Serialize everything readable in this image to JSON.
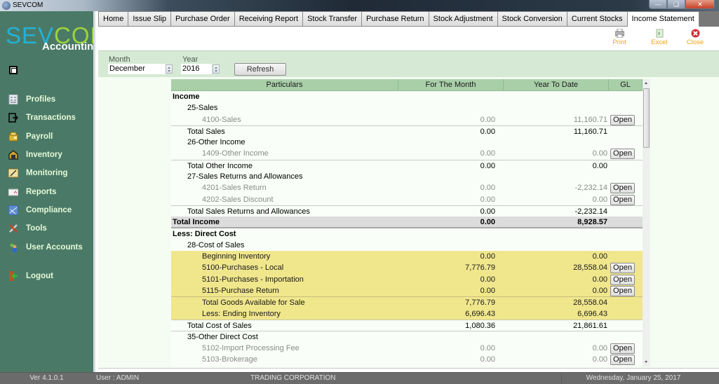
{
  "window": {
    "title": "SEVCOM",
    "controls": [
      "minimize",
      "maximize",
      "close"
    ]
  },
  "brand": {
    "logo_part1": "SEV",
    "logo_part2": "COM",
    "subtitle": "Accounting"
  },
  "sidebar": {
    "items": [
      {
        "label": "Profiles",
        "icon": "profiles-icon"
      },
      {
        "label": "Transactions",
        "icon": "transactions-icon"
      },
      {
        "label": "Payroll",
        "icon": "payroll-icon"
      },
      {
        "label": "Inventory",
        "icon": "inventory-icon"
      },
      {
        "label": "Monitoring",
        "icon": "monitoring-icon"
      },
      {
        "label": "Reports",
        "icon": "reports-icon"
      },
      {
        "label": "Compliance",
        "icon": "compliance-icon"
      },
      {
        "label": "Tools",
        "icon": "tools-icon"
      },
      {
        "label": "User Accounts",
        "icon": "user-accounts-icon"
      },
      {
        "label": "Logout",
        "icon": "logout-icon"
      }
    ]
  },
  "tabs": [
    {
      "label": "Home",
      "active": false
    },
    {
      "label": "Issue Slip",
      "active": false
    },
    {
      "label": "Purchase Order",
      "active": false
    },
    {
      "label": "Receiving Report",
      "active": false
    },
    {
      "label": "Stock Transfer",
      "active": false
    },
    {
      "label": "Purchase Return",
      "active": false
    },
    {
      "label": "Stock Adjustment",
      "active": false
    },
    {
      "label": "Stock Conversion",
      "active": false
    },
    {
      "label": "Current Stocks",
      "active": false
    },
    {
      "label": "Income Statement",
      "active": true
    }
  ],
  "toolbar": {
    "print_label": "Print",
    "excel_label": "Excel",
    "close_label": "Close"
  },
  "filter": {
    "month_label": "Month",
    "month_value": "December",
    "year_label": "Year",
    "year_value": "2016",
    "refresh_label": "Refresh"
  },
  "grid": {
    "columns": [
      "Particulars",
      "For The Month",
      "Year To Date",
      "GL"
    ],
    "open_label": "Open",
    "rows": [
      {
        "type": "header",
        "level": 0,
        "particulars": "Income",
        "month": "",
        "ytd": "",
        "gl": false
      },
      {
        "type": "group",
        "level": 1,
        "particulars": "25-Sales",
        "month": "",
        "ytd": "",
        "gl": false
      },
      {
        "type": "account",
        "level": 2,
        "particulars": "4100-Sales",
        "month": "0.00",
        "ytd": "11,160.71",
        "gl": true
      },
      {
        "type": "total",
        "level": 1,
        "particulars": "Total Sales",
        "month": "0.00",
        "ytd": "11,160.71",
        "gl": false
      },
      {
        "type": "group",
        "level": 1,
        "particulars": "26-Other Income",
        "month": "",
        "ytd": "",
        "gl": false
      },
      {
        "type": "account",
        "level": 2,
        "particulars": "1409-Other Income",
        "month": "0.00",
        "ytd": "0.00",
        "gl": true
      },
      {
        "type": "total",
        "level": 1,
        "particulars": "Total Other Income",
        "month": "0.00",
        "ytd": "0.00",
        "gl": false
      },
      {
        "type": "group",
        "level": 1,
        "particulars": "27-Sales Returns and Allowances",
        "month": "",
        "ytd": "",
        "gl": false
      },
      {
        "type": "account",
        "level": 2,
        "particulars": "4201-Sales Return",
        "month": "0.00",
        "ytd": "-2,232.14",
        "gl": true
      },
      {
        "type": "account",
        "level": 2,
        "particulars": "4202-Sales Discount",
        "month": "0.00",
        "ytd": "0.00",
        "gl": true
      },
      {
        "type": "total",
        "level": 1,
        "particulars": "Total Sales Returns and Allowances",
        "month": "0.00",
        "ytd": "-2,232.14",
        "gl": false
      },
      {
        "type": "grand",
        "level": 0,
        "particulars": "Total Income",
        "month": "0.00",
        "ytd": "8,928.57",
        "gl": false
      },
      {
        "type": "header",
        "level": 0,
        "particulars": "Less: Direct Cost",
        "month": "",
        "ytd": "",
        "gl": false
      },
      {
        "type": "group",
        "level": 1,
        "particulars": "28-Cost of Sales",
        "month": "",
        "ytd": "",
        "gl": false
      },
      {
        "type": "yellow",
        "level": 2,
        "particulars": "Beginning Inventory",
        "month": "0.00",
        "ytd": "0.00",
        "gl": false
      },
      {
        "type": "yellow",
        "level": 2,
        "particulars": "5100-Purchases - Local",
        "month": "7,776.79",
        "ytd": "28,558.04",
        "gl": true
      },
      {
        "type": "yellow",
        "level": 2,
        "particulars": "5101-Purchases - Importation",
        "month": "0.00",
        "ytd": "0.00",
        "gl": true
      },
      {
        "type": "yellow",
        "level": 2,
        "particulars": "5115-Purchase Return",
        "month": "0.00",
        "ytd": "0.00",
        "gl": true
      },
      {
        "type": "yellow-total",
        "level": 2,
        "particulars": "Total Goods Available for Sale",
        "month": "7,776.79",
        "ytd": "28,558.04",
        "gl": false
      },
      {
        "type": "yellow",
        "level": 2,
        "particulars": "Less: Ending Inventory",
        "month": "6,696.43",
        "ytd": "6,696.43",
        "gl": false
      },
      {
        "type": "total-after-yellow",
        "level": 1,
        "particulars": "Total Cost of Sales",
        "month": "1,080.36",
        "ytd": "21,861.61",
        "gl": false
      },
      {
        "type": "total",
        "level": 1,
        "particulars": "35-Other Direct Cost",
        "month": "",
        "ytd": "",
        "gl": false
      },
      {
        "type": "account",
        "level": 2,
        "particulars": "5102-Import Processing Fee",
        "month": "0.00",
        "ytd": "0.00",
        "gl": true
      },
      {
        "type": "account",
        "level": 2,
        "particulars": "5103-Brokerage",
        "month": "0.00",
        "ytd": "0.00",
        "gl": true
      }
    ]
  },
  "statusbar": {
    "version": "Ver 4.1.0.1",
    "user": "User : ADMIN",
    "company": "TRADING CORPORATION",
    "date": "Wednesday, January 25, 2017"
  }
}
